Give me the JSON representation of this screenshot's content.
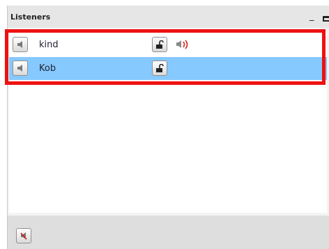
{
  "panel": {
    "title": "Listeners",
    "window_controls": [
      "minimize-icon",
      "maximize-icon"
    ]
  },
  "listeners": [
    {
      "name": "kind",
      "selected": false,
      "speaking": true,
      "icons": [
        "speaker-icon",
        "unlocked-icon",
        "speaking-icon"
      ]
    },
    {
      "name": "Kob",
      "selected": true,
      "speaking": false,
      "icons": [
        "speaker-icon",
        "unlocked-icon"
      ]
    }
  ],
  "footer": {
    "icons": [
      "mute-all-icon"
    ]
  },
  "colors": {
    "selected_row": "#86c9ff",
    "highlight_box": "#ee1111",
    "speaking_icon": "#d91c1c"
  }
}
